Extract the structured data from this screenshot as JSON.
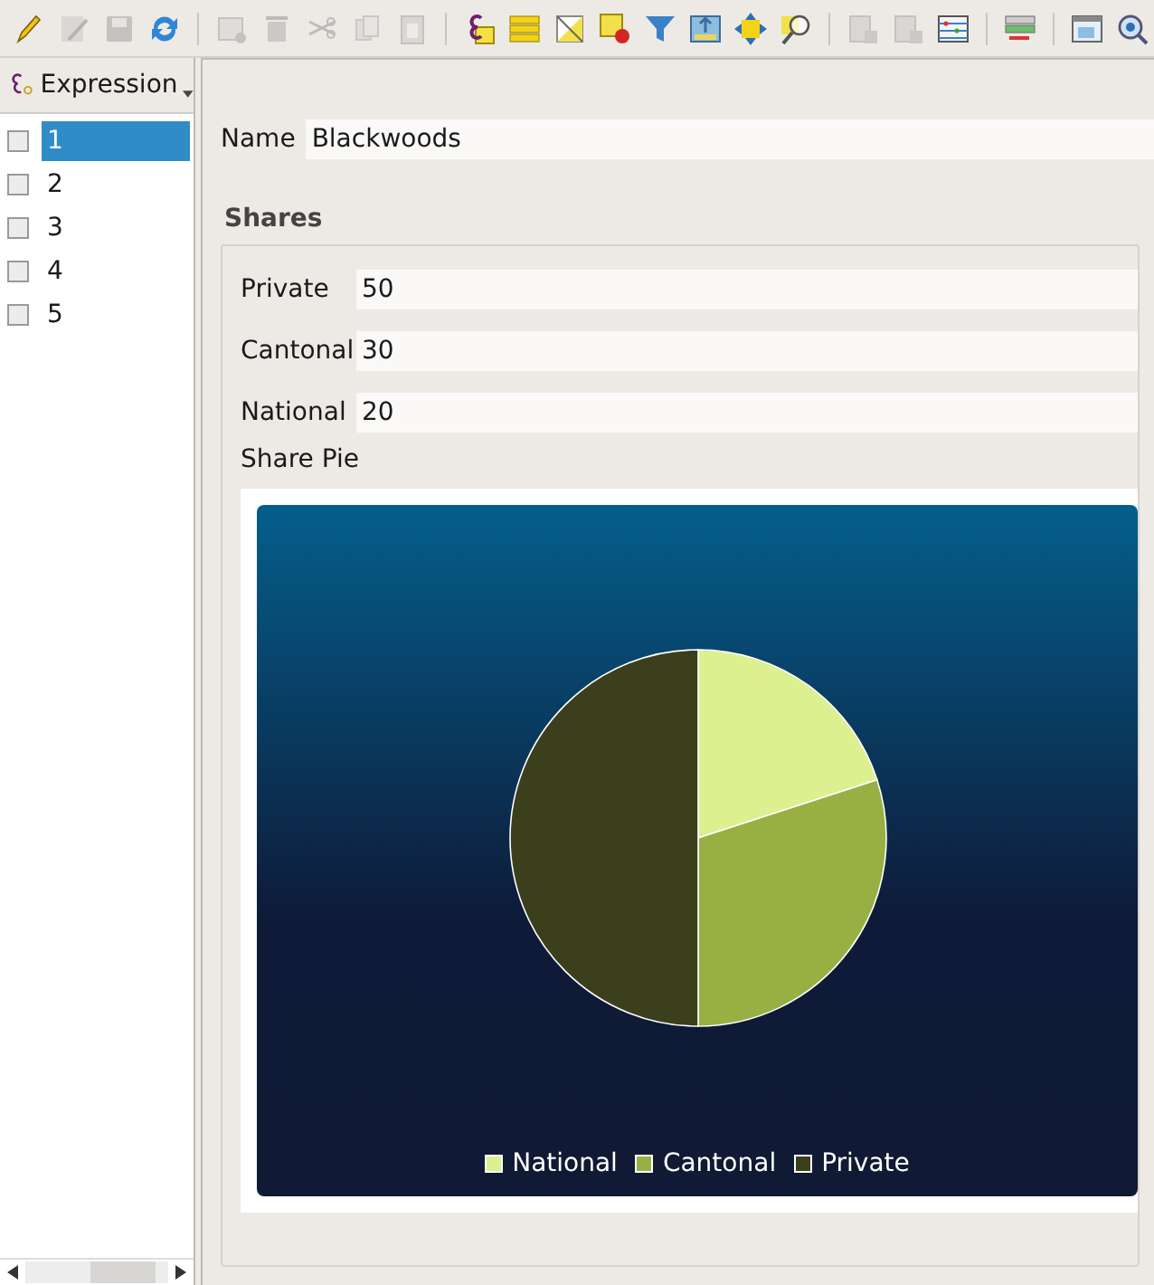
{
  "toolbar": [
    {
      "kind": "pencil",
      "disabled": false
    },
    {
      "kind": "edit",
      "disabled": true
    },
    {
      "kind": "save",
      "disabled": true
    },
    {
      "kind": "refresh",
      "disabled": false
    },
    {
      "kind": "separator"
    },
    {
      "kind": "table-gear",
      "disabled": true
    },
    {
      "kind": "trash",
      "disabled": true
    },
    {
      "kind": "scissors",
      "disabled": true
    },
    {
      "kind": "copy",
      "disabled": true
    },
    {
      "kind": "paste",
      "disabled": true
    },
    {
      "kind": "separator"
    },
    {
      "kind": "epsilon",
      "disabled": false
    },
    {
      "kind": "bars",
      "disabled": false
    },
    {
      "kind": "triangle",
      "disabled": false
    },
    {
      "kind": "deselect",
      "disabled": false
    },
    {
      "kind": "funnel",
      "disabled": false
    },
    {
      "kind": "move-top",
      "disabled": false
    },
    {
      "kind": "arrows",
      "disabled": false
    },
    {
      "kind": "magnifier",
      "disabled": false
    },
    {
      "kind": "separator"
    },
    {
      "kind": "column-add",
      "disabled": true
    },
    {
      "kind": "column-remove",
      "disabled": true
    },
    {
      "kind": "abacus",
      "disabled": false
    },
    {
      "kind": "separator"
    },
    {
      "kind": "rules",
      "disabled": false
    },
    {
      "kind": "separator"
    },
    {
      "kind": "form",
      "disabled": false
    },
    {
      "kind": "zoom-map",
      "disabled": false
    }
  ],
  "sidebar": {
    "header": "Expression",
    "items": [
      {
        "label": "1",
        "checked": false,
        "selected": true
      },
      {
        "label": "2",
        "checked": false,
        "selected": false
      },
      {
        "label": "3",
        "checked": false,
        "selected": false
      },
      {
        "label": "4",
        "checked": false,
        "selected": false
      },
      {
        "label": "5",
        "checked": false,
        "selected": false
      }
    ]
  },
  "form": {
    "name": {
      "label": "Name",
      "value": "Blackwoods"
    },
    "group": {
      "title": "Shares",
      "fields": [
        {
          "label": "Private",
          "value": "50"
        },
        {
          "label": "Cantonal",
          "value": "30"
        },
        {
          "label": "National",
          "value": "20"
        }
      ],
      "chart_label": "Share Pie",
      "chart_data": {
        "type": "pie",
        "categories": [
          "National",
          "Cantonal",
          "Private"
        ],
        "values": [
          20,
          30,
          50
        ],
        "legend": true
      }
    }
  }
}
